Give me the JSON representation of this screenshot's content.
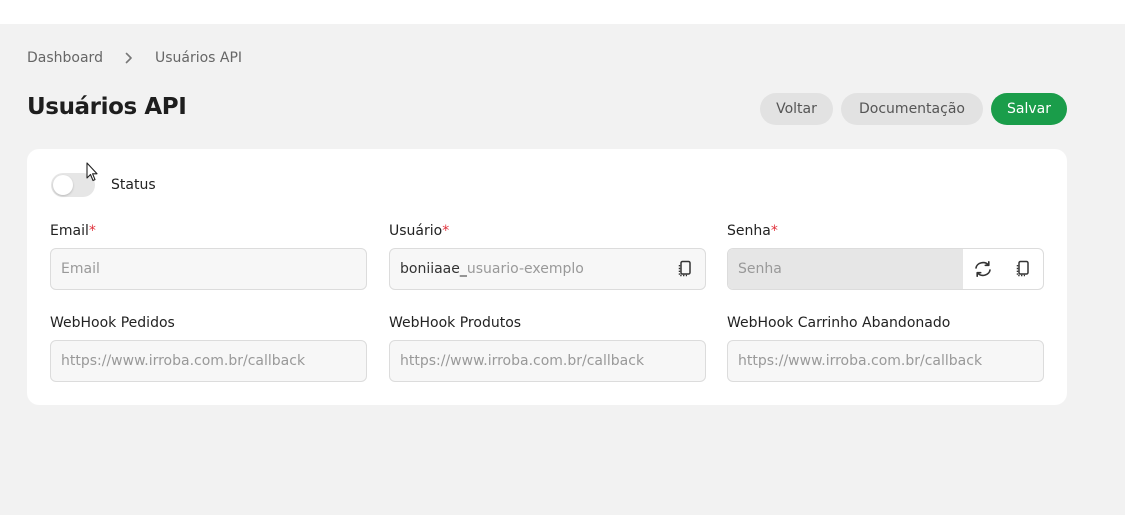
{
  "breadcrumb": {
    "home": "Dashboard",
    "current": "Usuários API"
  },
  "page": {
    "title": "Usuários API"
  },
  "actions": {
    "back": "Voltar",
    "docs": "Documentação",
    "save": "Salvar"
  },
  "status": {
    "label": "Status",
    "enabled": false
  },
  "fields": {
    "email": {
      "label": "Email",
      "required": "*",
      "placeholder": "Email",
      "value": ""
    },
    "usuario": {
      "label": "Usuário",
      "required": "*",
      "prefix": "boniiaae_",
      "suffix_placeholder": "usuario-exemplo"
    },
    "senha": {
      "label": "Senha",
      "required": "*",
      "placeholder": "Senha",
      "value": ""
    },
    "webhook_pedidos": {
      "label": "WebHook Pedidos",
      "placeholder": "https://www.irroba.com.br/callback",
      "value": ""
    },
    "webhook_produtos": {
      "label": "WebHook Produtos",
      "placeholder": "https://www.irroba.com.br/callback",
      "value": ""
    },
    "webhook_carrinho": {
      "label": "WebHook Carrinho Abandonado",
      "placeholder": "https://www.irroba.com.br/callback",
      "value": ""
    }
  },
  "icons": {
    "crumb_separator": "chevron-right-icon",
    "copy": "copy-icon",
    "refresh": "refresh-icon",
    "cursor": "mouse-pointer-icon"
  },
  "colors": {
    "primary": "#1a9d4a",
    "secondary_button": "#e2e2e2",
    "required": "#e0303a",
    "background": "#f2f2f2",
    "card": "#ffffff"
  }
}
